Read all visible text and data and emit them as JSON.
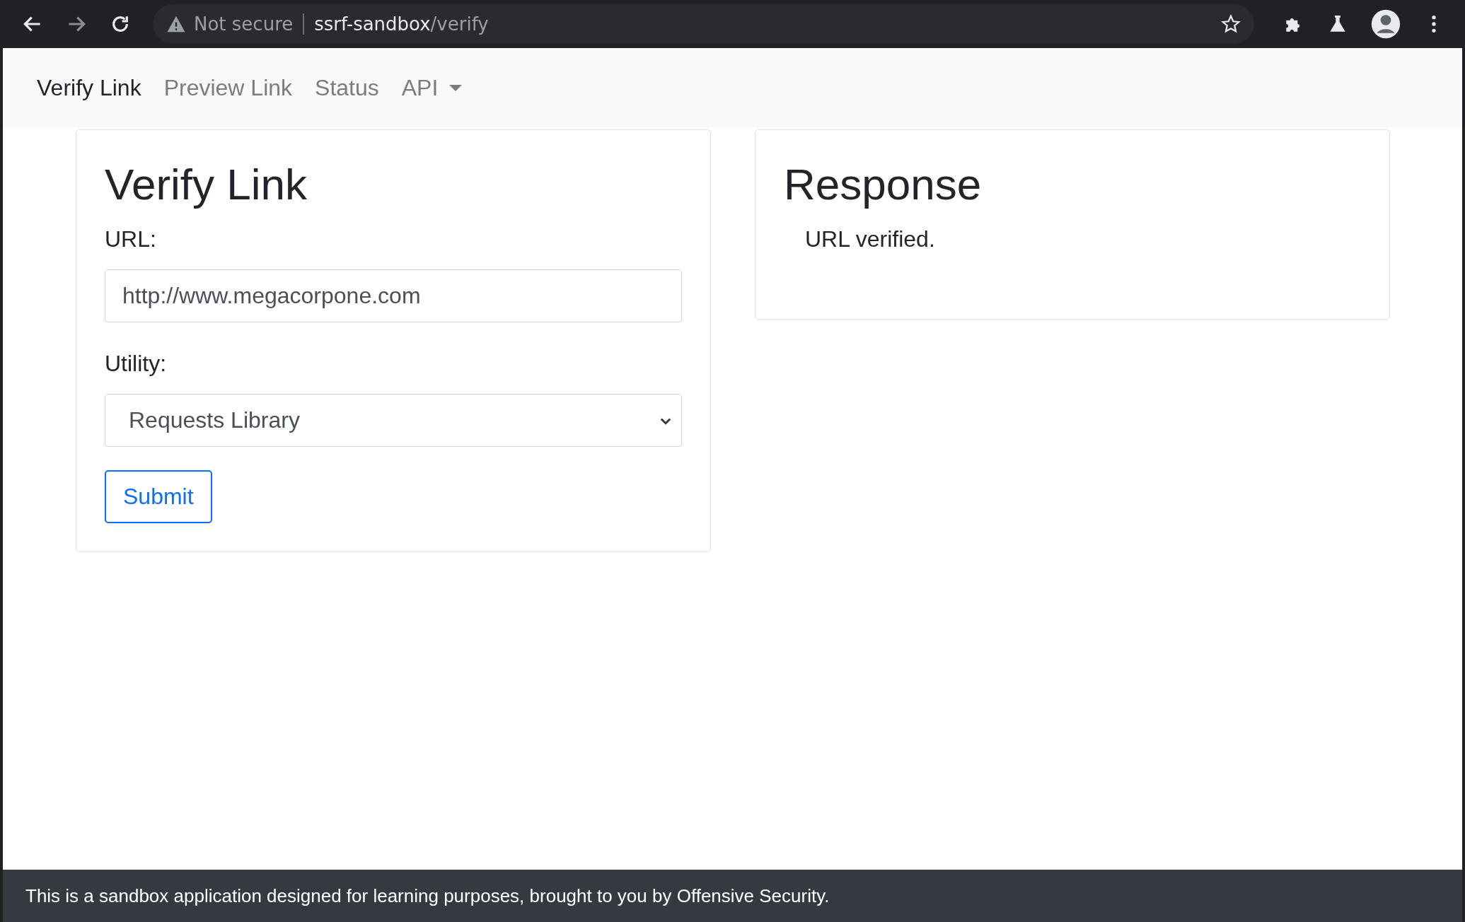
{
  "browser": {
    "security": "Not secure",
    "url_host": "ssrf-sandbox",
    "url_path": "/verify"
  },
  "nav": [
    {
      "label": "Verify Link",
      "selected": true,
      "kind": "link"
    },
    {
      "label": "Preview Link",
      "selected": false,
      "kind": "link"
    },
    {
      "label": "Status",
      "selected": false,
      "kind": "link"
    },
    {
      "label": "API",
      "selected": false,
      "kind": "dropdown"
    }
  ],
  "form": {
    "title": "Verify Link",
    "url_label": "URL:",
    "url_value": "http://www.megacorpone.com",
    "utility_label": "Utility:",
    "utility_value": "Requests Library",
    "submit": "Submit"
  },
  "response": {
    "title": "Response",
    "message": "URL verified."
  },
  "footer": "This is a sandbox application designed for learning purposes, brought to you by Offensive Security."
}
